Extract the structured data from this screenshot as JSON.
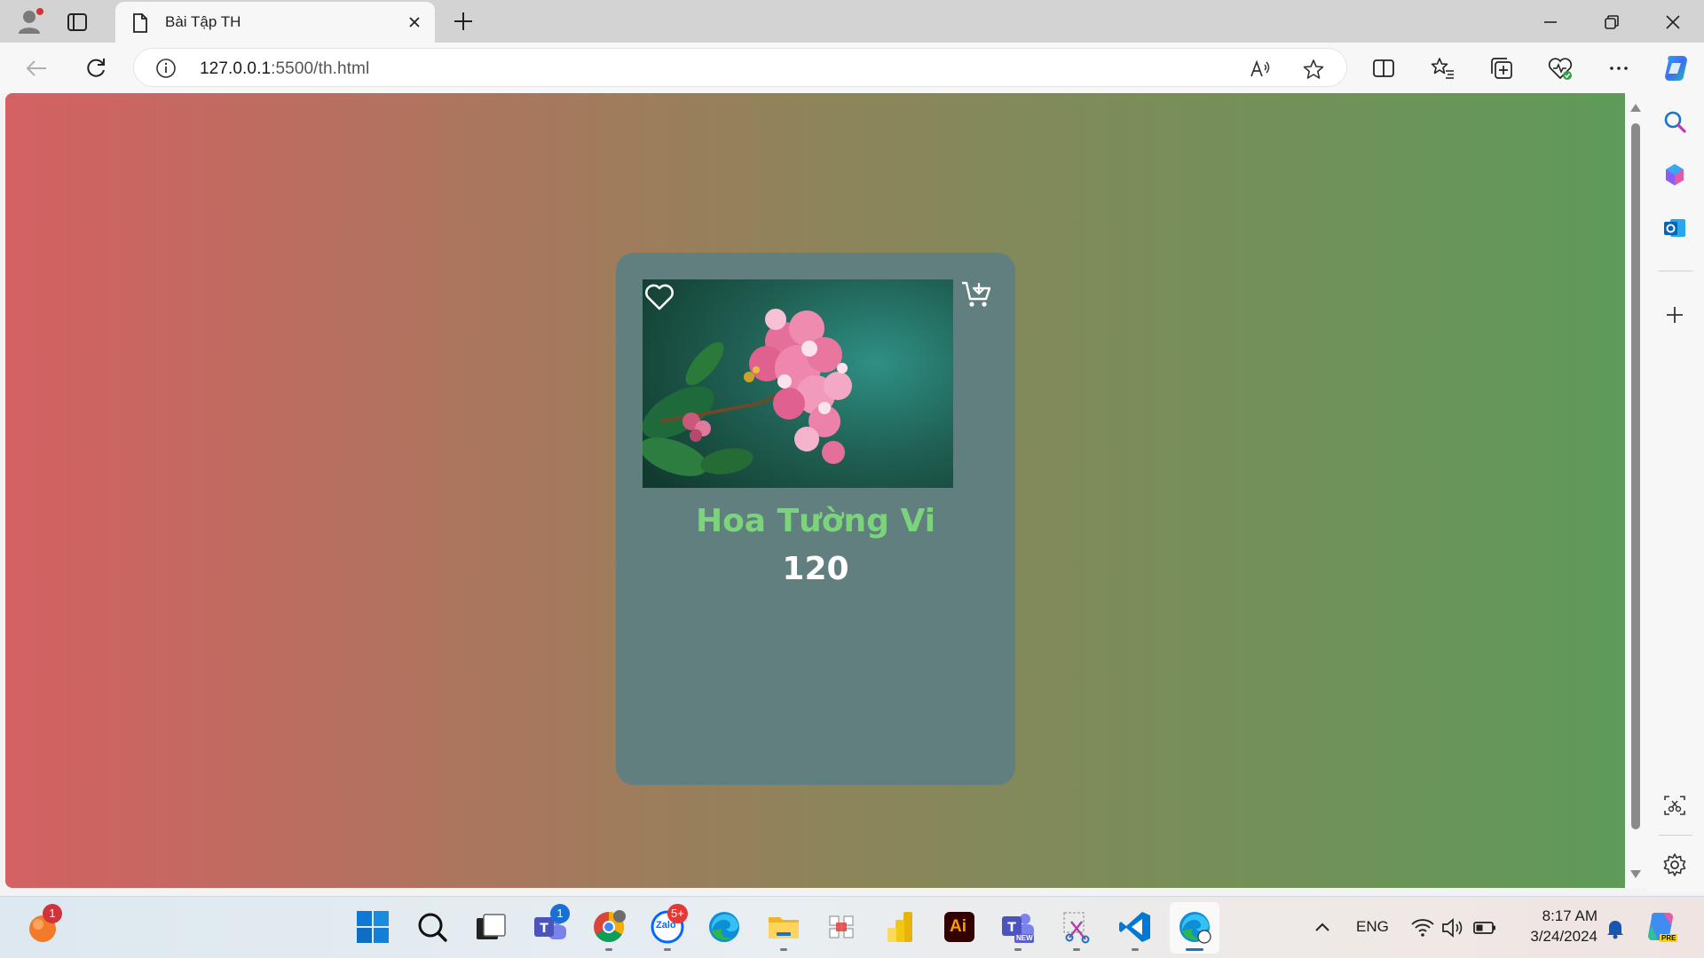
{
  "browser": {
    "tab": {
      "title": "Bài Tập TH"
    },
    "address": {
      "url_host": "127.0.0.1",
      "url_path": ":5500/th.html"
    }
  },
  "page": {
    "background_gradient": [
      "#d46163",
      "#8e845a",
      "#5e9a58"
    ],
    "card": {
      "background": "#617f7e",
      "product_name": "Hoa Tường Vi",
      "product_name_color": "#7bd37b",
      "price": "120",
      "image_subject": "pink crape myrtle flower on teal green background",
      "heart_icon": "heart-outline-icon",
      "cart_icon": "add-to-cart-icon"
    }
  },
  "taskbar": {
    "badges": {
      "notification_app": "1",
      "teams": "1",
      "zalo": "5+"
    },
    "zalo_label": "Zalo",
    "teams_new_label": "NEW",
    "illustrator_label": "Ai",
    "language": "ENG",
    "time": "8:17 AM",
    "date": "3/24/2024",
    "copilot_pre_label": "PRE"
  }
}
